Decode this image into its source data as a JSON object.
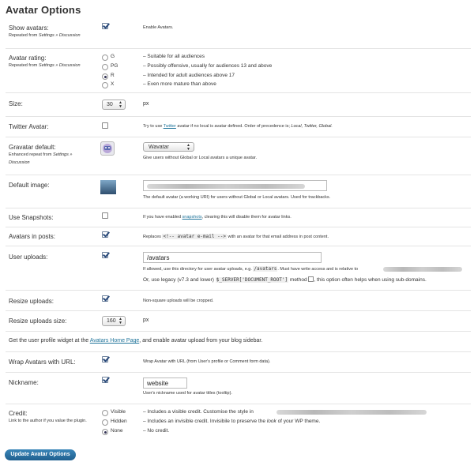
{
  "page_title": "Avatar Options",
  "show_avatars": {
    "label": "Show avatars:",
    "sub": "Repeated from",
    "sub_link": "Settings » Discussion",
    "desc": "Enable Avatars."
  },
  "avatar_rating": {
    "label": "Avatar rating:",
    "sub": "Repeated from",
    "sub_link": "Settings » Discussion",
    "options": [
      {
        "value": "G",
        "desc": "– Suitable for all audiences"
      },
      {
        "value": "PG",
        "desc": "– Possibly offensive, usually for audiences 13 and above"
      },
      {
        "value": "R",
        "desc": "– Intended for adult audiences above 17"
      },
      {
        "value": "X",
        "desc": "– Even more mature than above"
      }
    ]
  },
  "size": {
    "label": "Size:",
    "value": "30",
    "unit": "px"
  },
  "twitter": {
    "label": "Twitter Avatar:",
    "pre": "Try to use",
    "link": "Twitter",
    "post": "avatar if no local is avatar defined. Order of precedence is;",
    "order": "Local, Twitter, Global."
  },
  "gravatar": {
    "label": "Gravatar default:",
    "sub": "Enhanced repeat from",
    "sub_link": "Settings » Discussion",
    "select": "Wavatar",
    "desc": "Give users without Global or Local avatars a unique avatar."
  },
  "default_image": {
    "label": "Default image:",
    "desc": "The default avatar (a working URI) for users without Global or Local avatars. Used for trackbacks."
  },
  "snapshots": {
    "label": "Use Snapshots:",
    "pre": "If you have enabled",
    "link": "snapshots",
    "post": ", clearing this will disable them for avatar links."
  },
  "avatars_posts": {
    "label": "Avatars in posts:",
    "pre": "Replaces",
    "code": "<!-- avatar e-mail -->",
    "post": "with an avatar for that email address in post content."
  },
  "uploads": {
    "label": "User uploads:",
    "value": "/avatars",
    "desc1": "If allowed, use this directory for user avatar uploads, e.g.",
    "code1": "/avatars",
    "desc1b": ". Must have write access and is relative to",
    "desc2": "Or, use legacy (v7.3 and lower)",
    "code2": "$_SERVER['DOCUMENT_ROOT']",
    "desc2b": "method",
    "desc2c": ", this option often helps when using sub-domains."
  },
  "resize": {
    "label": "Resize uploads:",
    "desc": "Non-square uploads will be cropped."
  },
  "resize_size": {
    "label": "Resize uploads size:",
    "value": "160",
    "unit": "px"
  },
  "widget_note": {
    "pre": "Get the user profile widget at the",
    "link": "Avatars Home Page",
    "post": ", and enable avatar upload from your blog sidebar."
  },
  "wrap": {
    "label": "Wrap Avatars with URL:",
    "desc": "Wrap Avatar with URL (from User's profile or Comment form data)."
  },
  "nickname": {
    "label": "Nickname:",
    "value": "website",
    "desc": "User's nickname used for avatar titles (tooltip)."
  },
  "credit": {
    "label": "Credit:",
    "sub": "Link to the author if you value the plugin.",
    "options": [
      {
        "value": "Visible",
        "desc": "– Includes a visible credit. Customise the style in"
      },
      {
        "value": "Hidden",
        "desc": "– Includes an invisible credit. Invisibile to preserve the",
        "desc_i": "look",
        "desc_b": "of your WP theme."
      },
      {
        "value": "None",
        "desc": "– No credit."
      }
    ]
  },
  "submit": "Update Avatar Options"
}
